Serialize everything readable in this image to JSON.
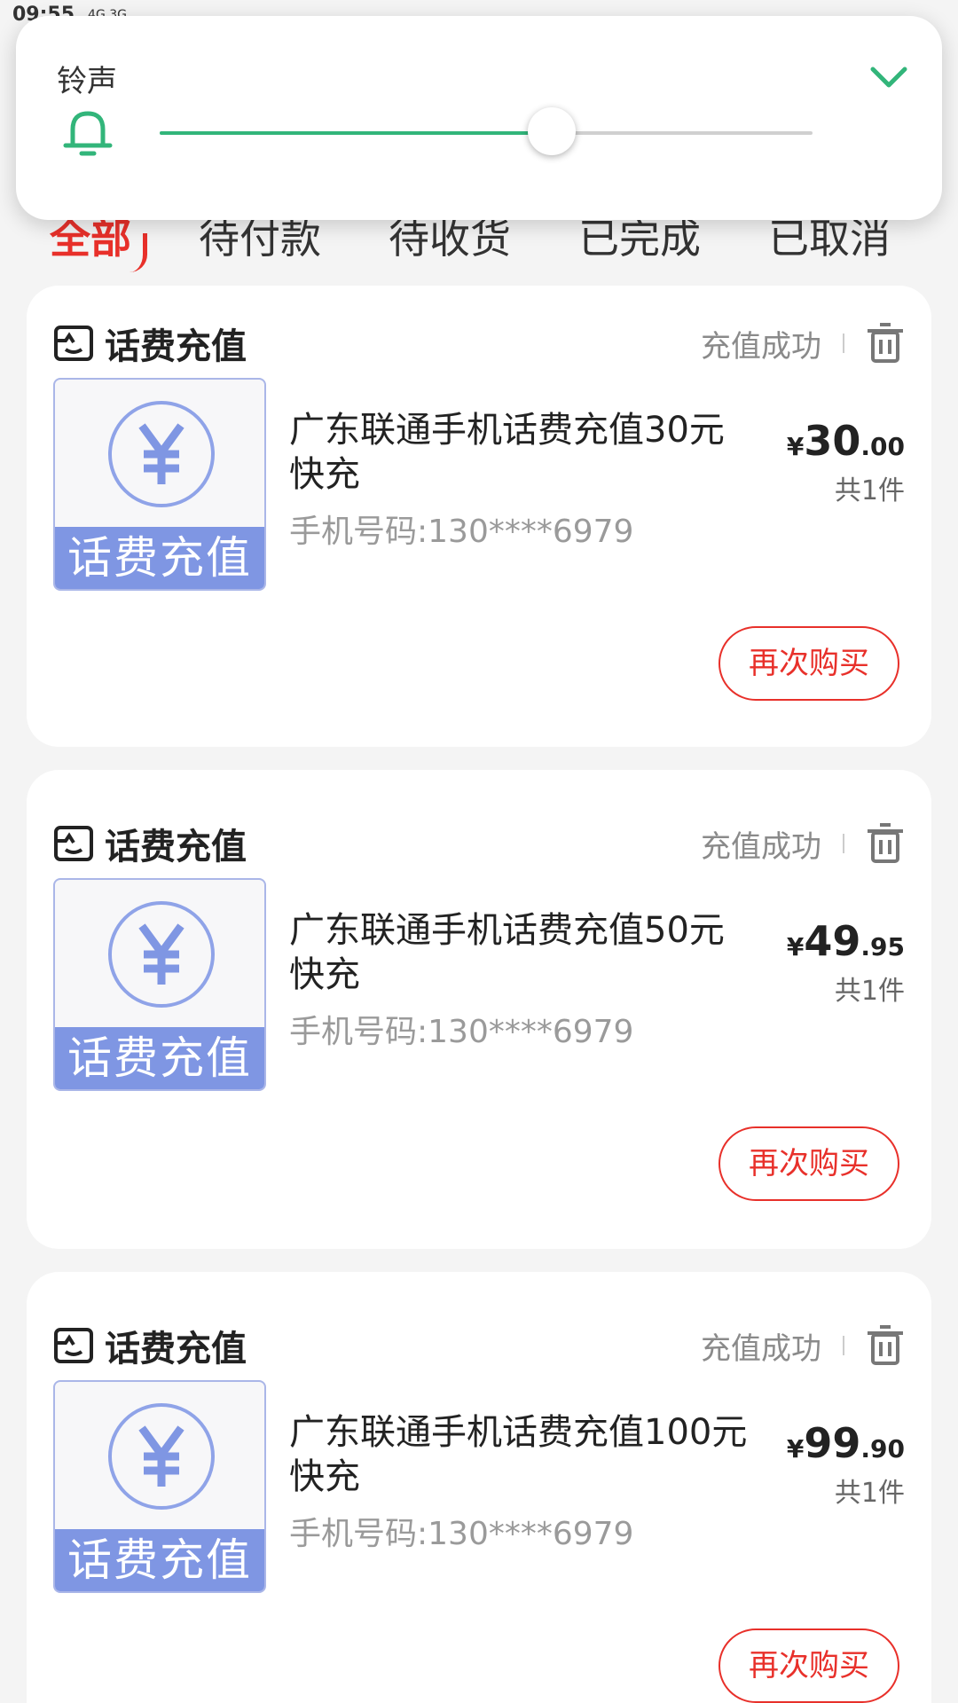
{
  "status_bar": {
    "time": "09:55",
    "network": "4G 3G"
  },
  "volume": {
    "label": "铃声",
    "level": 0.6,
    "accent_color": "#32b57a",
    "icon": "bell-icon",
    "collapse_icon": "chevron-down-icon"
  },
  "tabs": [
    {
      "label": "全部",
      "active": true
    },
    {
      "label": "待付款",
      "active": false
    },
    {
      "label": "待收货",
      "active": false
    },
    {
      "label": "已完成",
      "active": false
    },
    {
      "label": "已取消",
      "active": false
    }
  ],
  "orders": [
    {
      "title": "话费充值",
      "status": "充值成功",
      "thumb_label": "话费充值",
      "product": "广东联通手机话费充值30元快充",
      "phone": "手机号码:130****6979",
      "currency": "¥",
      "price_int": "30",
      "price_dec": ".00",
      "qty": "共1件",
      "action": "再次购买"
    },
    {
      "title": "话费充值",
      "status": "充值成功",
      "thumb_label": "话费充值",
      "product": "广东联通手机话费充值50元快充",
      "phone": "手机号码:130****6979",
      "currency": "¥",
      "price_int": "49",
      "price_dec": ".95",
      "qty": "共1件",
      "action": "再次购买"
    },
    {
      "title": "话费充值",
      "status": "充值成功",
      "thumb_label": "话费充值",
      "product": "广东联通手机话费充值100元 快充",
      "phone": "手机号码:130****6979",
      "currency": "¥",
      "price_int": "99",
      "price_dec": ".90",
      "qty": "共1件",
      "action": "再次购买"
    }
  ],
  "colors": {
    "accent_red": "#e8302a",
    "thumb_blue": "#7f96e3"
  }
}
